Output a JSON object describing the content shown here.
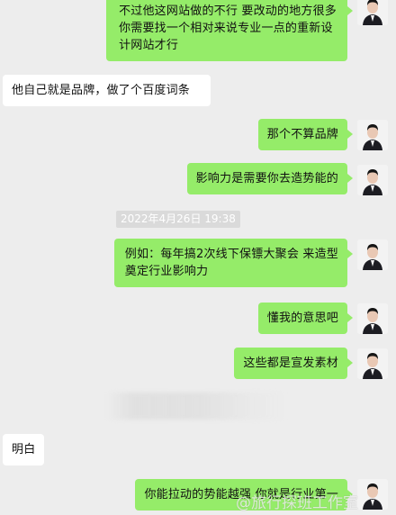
{
  "chat": {
    "timestamp": "2022年4月26日 19:38",
    "messages": [
      {
        "side": "out",
        "lines": [
          "不过他这网站做的不行  要改动的地方很多",
          "你需要找一个相对来说专业一点的重新设",
          "计网站才行"
        ]
      },
      {
        "side": "in",
        "lines": [
          "他自己就是品牌，做了个百度词条"
        ]
      },
      {
        "side": "out",
        "lines": [
          "那个不算品牌"
        ]
      },
      {
        "side": "out",
        "lines": [
          "影响力是需要你去造势能的"
        ]
      },
      {
        "side": "out",
        "lines": [
          "例如：每年搞2次线下保镖大聚会   来造型",
          "奠定行业影响力"
        ]
      },
      {
        "side": "out",
        "lines": [
          "懂我的意思吧"
        ]
      },
      {
        "side": "out",
        "lines": [
          "这些都是宣发素材"
        ]
      },
      {
        "side": "in",
        "lines": [
          "明白"
        ]
      },
      {
        "side": "out",
        "lines": [
          "你能拉动的势能越强 你就是行业第一"
        ]
      }
    ]
  },
  "watermark": "@旅行探班工作室",
  "colors": {
    "background": "#ededed",
    "outgoing_bubble": "#95ec69",
    "incoming_bubble": "#ffffff"
  },
  "icons": {
    "avatar": "user-avatar-photo"
  }
}
